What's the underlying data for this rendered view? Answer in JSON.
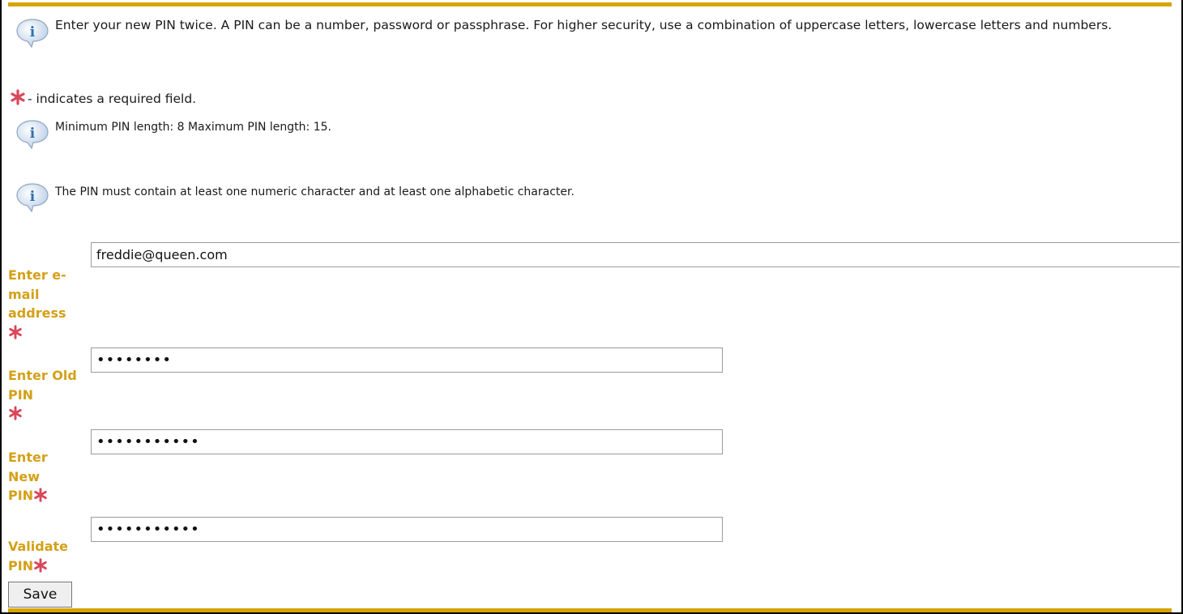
{
  "intro": "Enter your new PIN twice. A PIN can be a number, password or passphrase. For higher security, use a combination of uppercase letters, lowercase letters and numbers.",
  "required_note": " - indicates a required field.",
  "pin_length_info": "Minimum PIN length: 8 Maximum PIN length: 15.",
  "pin_rule_info": "The PIN must contain at least one numeric character and at least one alphabetic character.",
  "icons": {
    "info": "info-icon",
    "required": "required-star-icon"
  },
  "colors": {
    "accent_bar": "#d9a400",
    "label": "#d4a017",
    "required_star": "#d9475a",
    "info_bubble": "#2d6fb5"
  },
  "fields": {
    "email": {
      "label": "Enter e-mail address",
      "value": "freddie@queen.com"
    },
    "old_pin": {
      "label": "Enter Old PIN",
      "value": "••••••••"
    },
    "new_pin": {
      "label": "Enter New PIN",
      "value": "•••••••••••"
    },
    "validate_pin": {
      "label": "Validate PIN",
      "value": "•••••••••••"
    }
  },
  "save_label": "Save"
}
